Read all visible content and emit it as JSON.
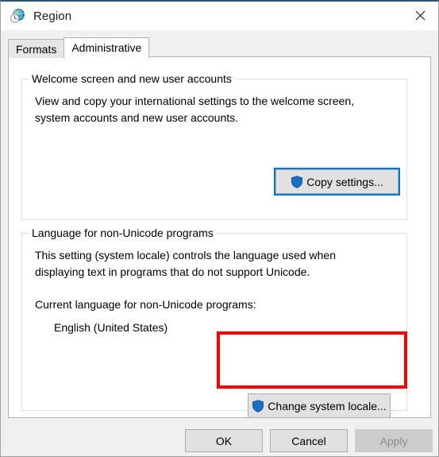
{
  "window": {
    "title": "Region",
    "title_icon": "region-globe-clock-icon",
    "close_label": "✕"
  },
  "tabs": [
    {
      "label": "Formats",
      "selected": false,
      "name": "tab-formats"
    },
    {
      "label": "Administrative",
      "selected": true,
      "name": "tab-administrative"
    }
  ],
  "groups": {
    "welcome": {
      "legend": "Welcome screen and new user accounts",
      "description": "View and copy your international settings to the welcome screen, system accounts and new user accounts.",
      "button": {
        "label": "Copy settings...",
        "icon": "uac-shield-icon",
        "focused": true
      }
    },
    "language": {
      "legend": "Language for non-Unicode programs",
      "description": "This setting (system locale) controls the language used when displaying text in programs that do not support Unicode.",
      "current_label": "Current language for non-Unicode programs:",
      "current_value": "English (United States)",
      "button": {
        "label": "Change system locale...",
        "icon": "uac-shield-icon",
        "focused": false
      }
    }
  },
  "annotation": {
    "type": "red-rectangle-highlight",
    "target": "change-system-locale-button",
    "color": "#ff0000"
  },
  "footer": {
    "ok_label": "OK",
    "cancel_label": "Cancel",
    "apply_label": "Apply",
    "apply_enabled": false
  },
  "colors": {
    "accent_focus": "#0078d7",
    "highlight": "#ff0000",
    "dialog_bg": "#f0f0f0",
    "page_bg": "#ffffff",
    "button_face": "#e1e1e1",
    "disabled_text": "#8d8d8d"
  }
}
